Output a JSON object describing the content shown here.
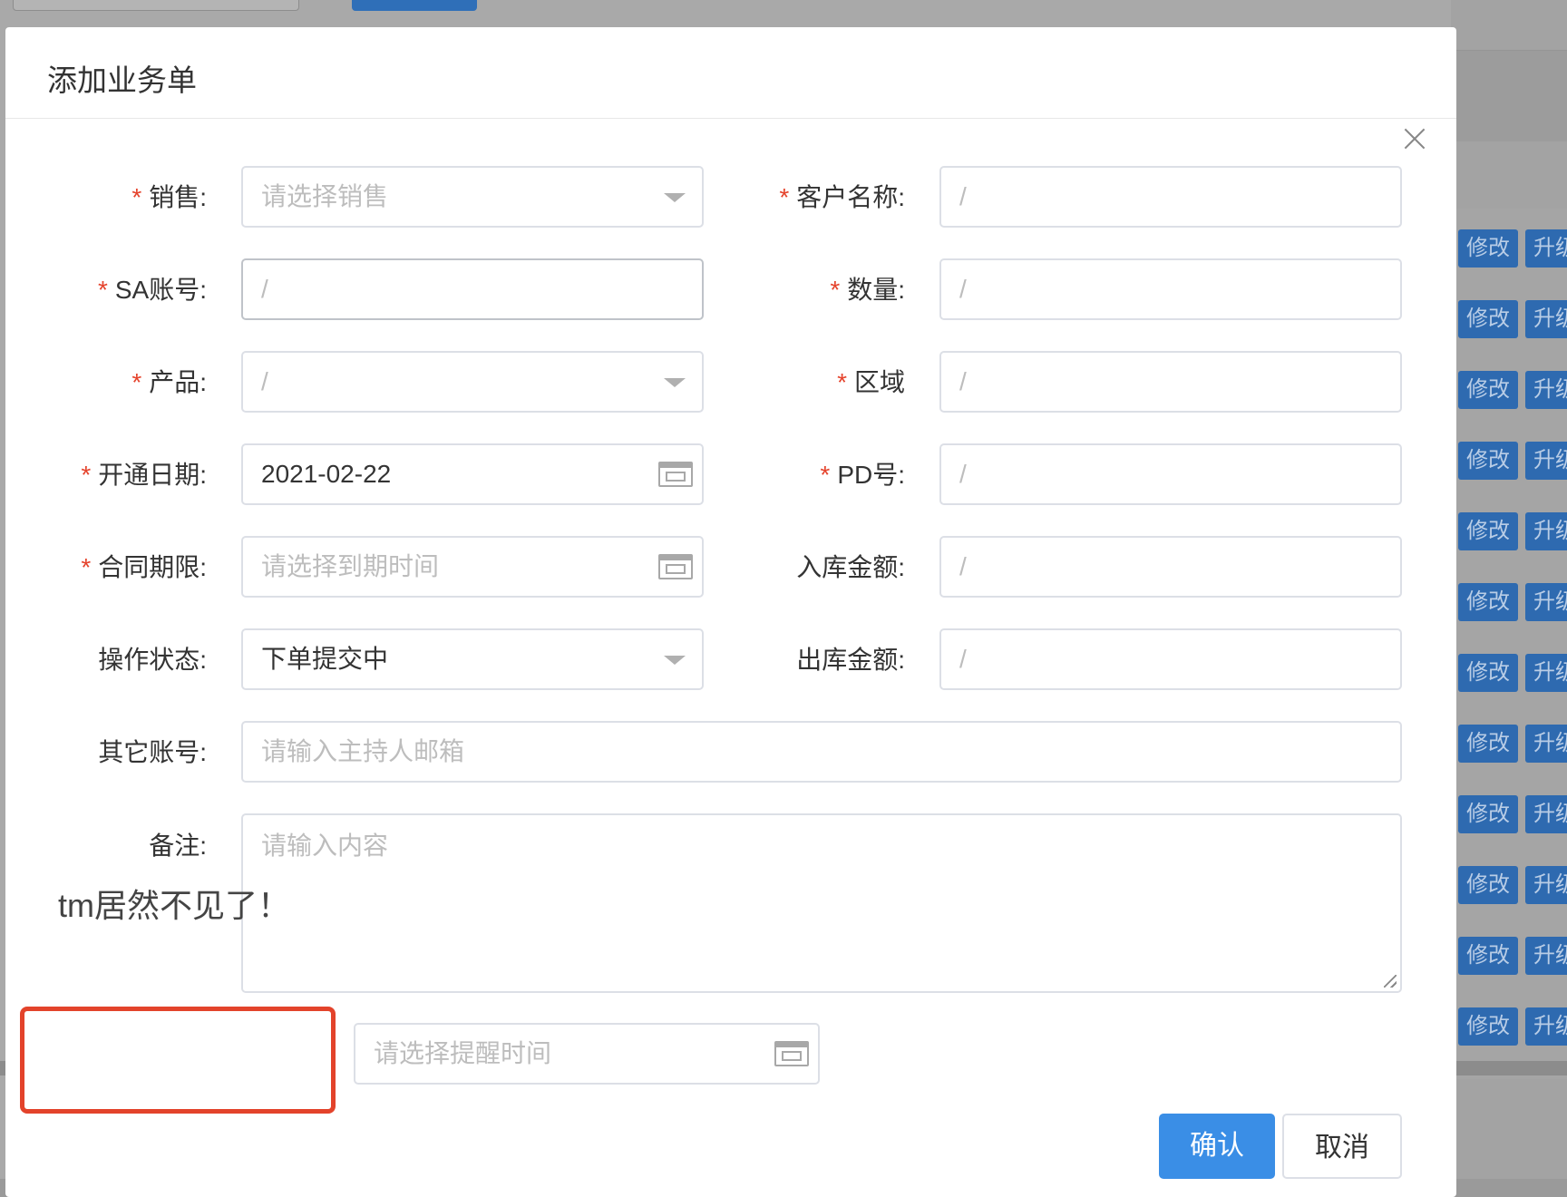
{
  "background": {
    "row_actions": [
      {
        "edit": "修改",
        "upgrade": "升级"
      },
      {
        "edit": "修改",
        "upgrade": "升级"
      },
      {
        "edit": "修改",
        "upgrade": "升级"
      },
      {
        "edit": "修改",
        "upgrade": "升级"
      },
      {
        "edit": "修改",
        "upgrade": "升级"
      },
      {
        "edit": "修改",
        "upgrade": "升级"
      },
      {
        "edit": "修改",
        "upgrade": "升级"
      },
      {
        "edit": "修改",
        "upgrade": "升级"
      },
      {
        "edit": "修改",
        "upgrade": "升级"
      },
      {
        "edit": "修改",
        "upgrade": "升级"
      },
      {
        "edit": "修改",
        "upgrade": "升级"
      },
      {
        "edit": "修改",
        "upgrade": "升级"
      }
    ]
  },
  "dialog": {
    "title": "添加业务单",
    "close_icon": "close-icon",
    "fields": {
      "sales": {
        "label": "销售:",
        "required": "*",
        "placeholder": "请选择销售"
      },
      "customer": {
        "label": "客户名称:",
        "required": "*",
        "value": "/"
      },
      "sa_account": {
        "label": "SA账号:",
        "required": "*",
        "value": "/"
      },
      "quantity": {
        "label": "数量:",
        "required": "*",
        "value": "/"
      },
      "product": {
        "label": "产品:",
        "required": "*",
        "value": "/"
      },
      "region": {
        "label": "区域",
        "required": "*",
        "value": "/"
      },
      "open_date": {
        "label": "开通日期:",
        "required": "*",
        "value": "2021-02-22"
      },
      "pd_no": {
        "label": "PD号:",
        "required": "*",
        "value": "/"
      },
      "contract_term": {
        "label": "合同期限:",
        "required": "*",
        "placeholder": "请选择到期时间"
      },
      "inbound_amount": {
        "label": "入库金额:",
        "value": "/"
      },
      "status": {
        "label": "操作状态:",
        "value": "下单提交中"
      },
      "outbound_amount": {
        "label": "出库金额:",
        "value": "/"
      },
      "other_account": {
        "label": "其它账号:",
        "placeholder": "请输入主持人邮箱"
      },
      "remark": {
        "label": "备注:",
        "placeholder": "请输入内容"
      },
      "reminder": {
        "placeholder": "请选择提醒时间"
      }
    },
    "annotation": "tm居然不见了！",
    "buttons": {
      "confirm": "确认",
      "cancel": "取消"
    },
    "accent_color": "#3a8ee6",
    "required_color": "#e5432c"
  }
}
